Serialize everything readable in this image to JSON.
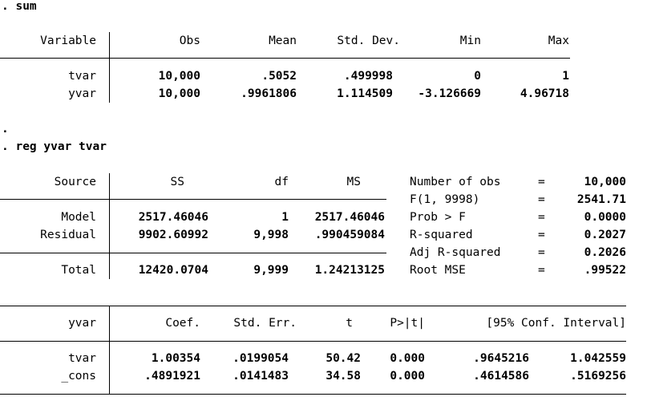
{
  "sum_cmd": ". sum",
  "sum_table": {
    "headers": [
      "Variable",
      "Obs",
      "Mean",
      "Std. Dev.",
      "Min",
      "Max"
    ],
    "rows": [
      [
        "tvar",
        "10,000",
        ".5052",
        ".499998",
        "0",
        "1"
      ],
      [
        "yvar",
        "10,000",
        ".9961806",
        "1.114509",
        "-3.126669",
        "4.96718"
      ]
    ]
  },
  "dot_line": ".",
  "reg_cmd": ". reg yvar tvar",
  "anova_table": {
    "headers": [
      "Source",
      "SS",
      "df",
      "MS"
    ],
    "rows": [
      [
        "Model",
        "2517.46046",
        "1",
        "2517.46046"
      ],
      [
        "Residual",
        "9902.60992",
        "9,998",
        ".990459084"
      ]
    ],
    "total": [
      "Total",
      "12420.0704",
      "9,999",
      "1.24213125"
    ]
  },
  "stats": [
    {
      "label": "Number of obs",
      "eq": "=",
      "value": "10,000"
    },
    {
      "label": "F(1, 9998)",
      "eq": "=",
      "value": "2541.71"
    },
    {
      "label": "Prob > F",
      "eq": "=",
      "value": "0.0000"
    },
    {
      "label": "R-squared",
      "eq": "=",
      "value": "0.2027"
    },
    {
      "label": "Adj R-squared",
      "eq": "=",
      "value": "0.2026"
    },
    {
      "label": "Root MSE",
      "eq": "=",
      "value": ".99522"
    }
  ],
  "coef_table": {
    "headers": [
      "yvar",
      "Coef.",
      "Std. Err.",
      "t",
      "P>|t|",
      "[95% Conf. Interval]"
    ],
    "rows": [
      [
        "tvar",
        "1.00354",
        ".0199054",
        "50.42",
        "0.000",
        ".9645216",
        "1.042559"
      ],
      [
        "_cons",
        ".4891921",
        ".0141483",
        "34.58",
        "0.000",
        ".4614586",
        ".5169256"
      ]
    ]
  }
}
